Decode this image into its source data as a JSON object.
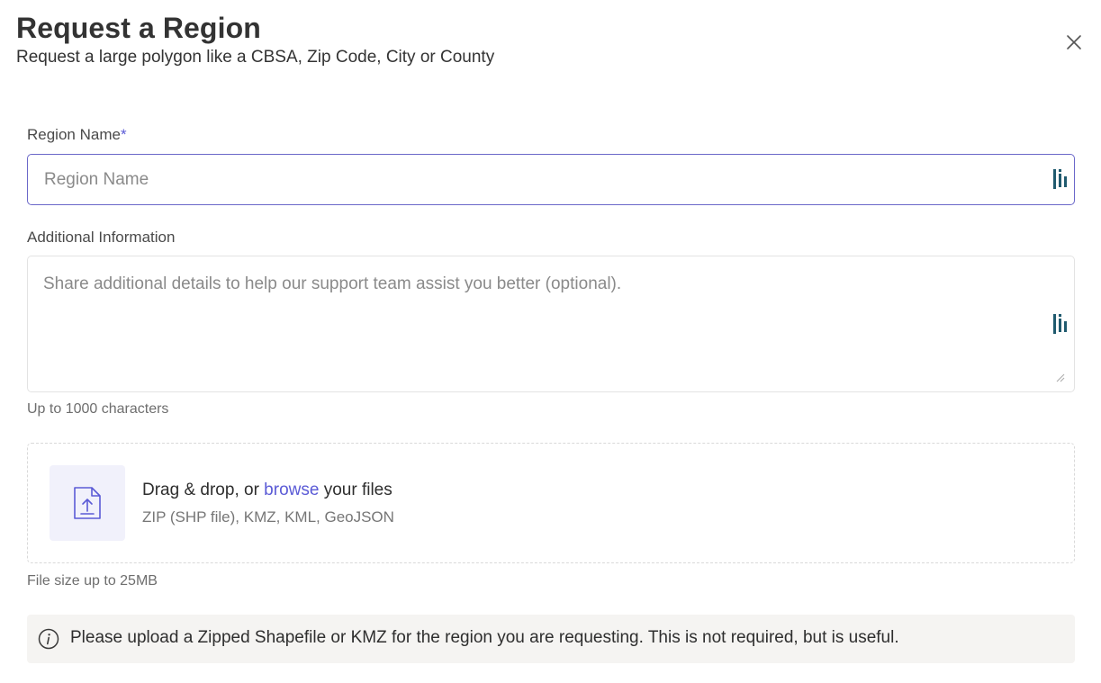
{
  "header": {
    "title": "Request a Region",
    "subtitle": "Request a large polygon like a CBSA, Zip Code, City or County",
    "close_icon": "close-icon"
  },
  "form": {
    "region_name": {
      "label": "Region Name",
      "required_marker": "*",
      "value": "",
      "placeholder": "Region Name"
    },
    "additional_info": {
      "label": "Additional Information",
      "value": "",
      "placeholder": "Share additional details to help our support team assist you better (optional).",
      "helper": "Up to 1000 characters"
    }
  },
  "upload": {
    "icon": "file-upload-icon",
    "prefix": "Drag & drop, or ",
    "browse_link": "browse",
    "suffix": " your files",
    "formats": "ZIP (SHP file), KMZ, KML, GeoJSON",
    "size_limit": "File size up to 25MB"
  },
  "notice": {
    "icon": "info-icon",
    "text": "Please upload a Zipped Shapefile or KMZ for the region you are requesting. This is not required, but is useful."
  },
  "colors": {
    "accent": "#5b5bd6",
    "input_border_focus": "#6b68c9",
    "extension_icon": "#1f5a6e",
    "notice_bg": "#f5f4f2",
    "upload_tile_bg": "#f1f1fb"
  }
}
